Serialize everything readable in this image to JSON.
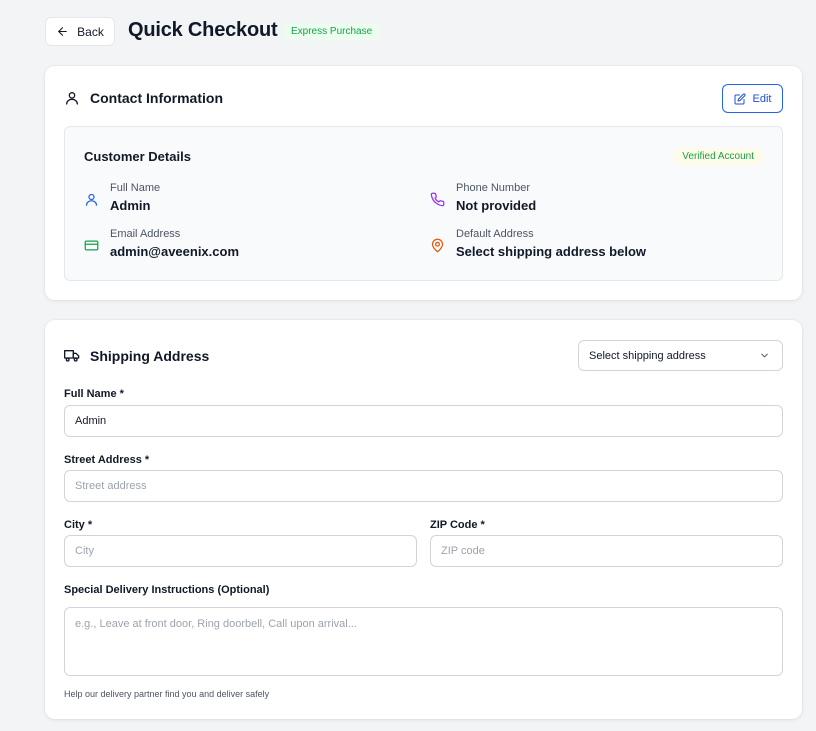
{
  "header": {
    "back_label": "Back",
    "title": "Quick Checkout",
    "badge": "Express Purchase"
  },
  "contact": {
    "section_title": "Contact Information",
    "edit_label": "Edit",
    "details_title": "Customer Details",
    "verified_label": "Verified Account",
    "fields": [
      {
        "label": "Full Name",
        "value": "Admin",
        "icon": "user-icon",
        "color": "#2563eb"
      },
      {
        "label": "Phone Number",
        "value": "Not provided",
        "icon": "phone-icon",
        "color": "#9333ea"
      },
      {
        "label": "Email Address",
        "value": "admin@aveenix.com",
        "icon": "credit-card-icon",
        "color": "#16a34a"
      },
      {
        "label": "Default Address",
        "value": "Select shipping address below",
        "icon": "map-pin-icon",
        "color": "#ea580c"
      }
    ]
  },
  "shipping": {
    "section_title": "Shipping Address",
    "select_label": "Select shipping address",
    "full_name_label": "Full Name *",
    "full_name_value": "Admin",
    "street_label": "Street Address *",
    "street_placeholder": "Street address",
    "city_label": "City *",
    "city_placeholder": "City",
    "zip_label": "ZIP Code *",
    "zip_placeholder": "ZIP code",
    "instructions_label": "Special Delivery Instructions (Optional)",
    "instructions_placeholder": "e.g., Leave at front door, Ring doorbell, Call upon arrival...",
    "hint": "Help our delivery partner find you and deliver safely"
  },
  "colors": {
    "accent": "#2563eb",
    "badge_green": "#16a34a"
  }
}
